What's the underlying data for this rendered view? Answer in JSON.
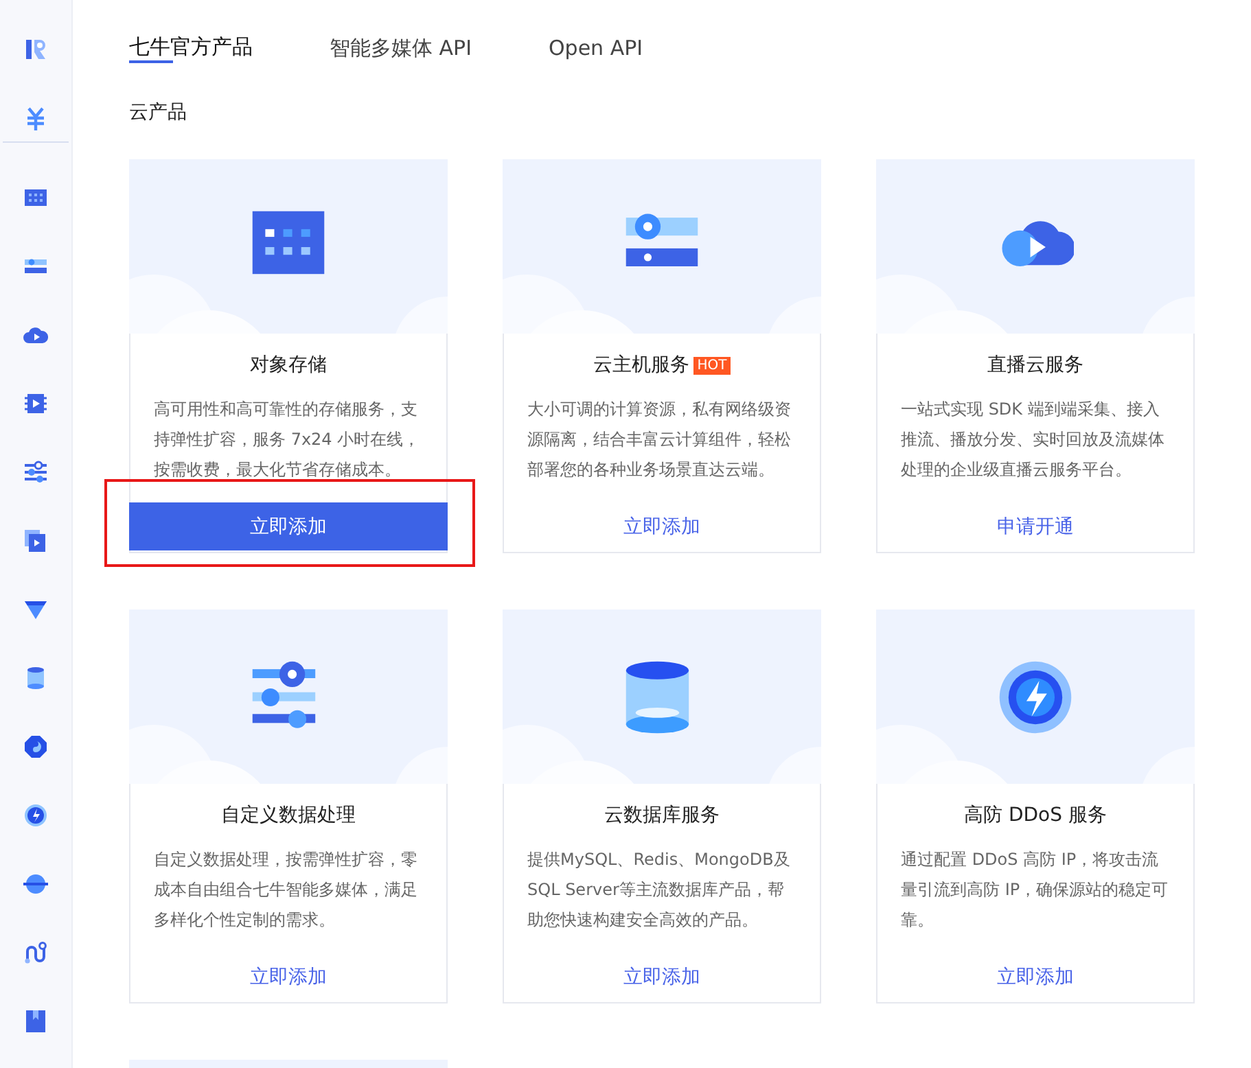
{
  "tabs": [
    {
      "label": "七牛官方产品",
      "selected": true
    },
    {
      "label": "智能多媒体 API",
      "selected": false
    },
    {
      "label": "Open API",
      "selected": false
    }
  ],
  "section_title": "云产品",
  "products": [
    {
      "title": "对象存储",
      "description": "高可用性和高可靠性的存储服务，支持弹性扩容，服务 7x24 小时在线，按需收费，最大化节省存储成本。",
      "action": {
        "label": "立即添加",
        "kind": "primary"
      },
      "highlighted": true
    },
    {
      "title": "云主机服务",
      "badge": "HOT",
      "description": "大小可调的计算资源，私有网络级资源隔离，结合丰富云计算组件，轻松部署您的各种业务场景直达云端。",
      "action": {
        "label": "立即添加",
        "kind": "link"
      },
      "highlighted": false
    },
    {
      "title": "直播云服务",
      "description": "一站式实现 SDK 端到端采集、接入推流、播放分发、实时回放及流媒体处理的企业级直播云服务平台。",
      "action": {
        "label": "申请开通",
        "kind": "link"
      },
      "highlighted": false
    },
    {
      "title": "自定义数据处理",
      "description": "自定义数据处理，按需弹性扩容，零成本自由组合七牛智能多媒体，满足多样化个性定制的需求。",
      "action": {
        "label": "立即添加",
        "kind": "link"
      },
      "highlighted": false
    },
    {
      "title": "云数据库服务",
      "description": "提供MySQL、Redis、MongoDB及SQL Server等主流数据库产品，帮助您快速构建安全高效的产品。",
      "action": {
        "label": "立即添加",
        "kind": "link"
      },
      "highlighted": false
    },
    {
      "title": "高防 DDoS 服务",
      "description": "通过配置 DDoS 高防 IP，将攻击流量引流到高防 IP，确保源站的稳定可靠。",
      "action": {
        "label": "立即添加",
        "kind": "link"
      },
      "highlighted": false
    }
  ]
}
